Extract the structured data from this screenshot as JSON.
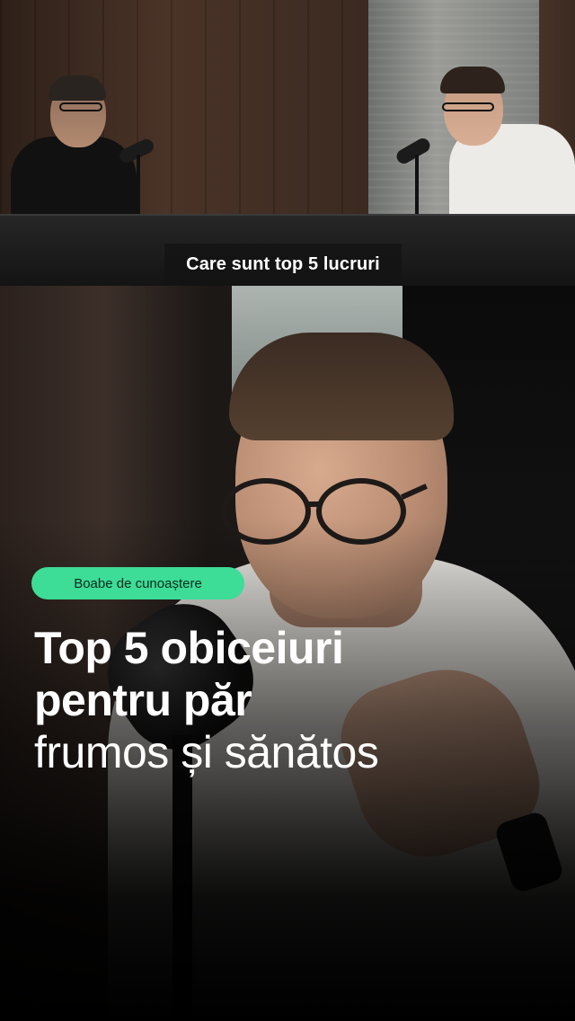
{
  "caption": {
    "text": "Care sunt top 5 lucruri"
  },
  "tag": {
    "label": "Boabe de cunoaștere",
    "color": "#3ddc97"
  },
  "headline": {
    "line1": "Top 5 obiceiuri",
    "line2": "pentru păr",
    "line3": "frumos și sănătos"
  }
}
